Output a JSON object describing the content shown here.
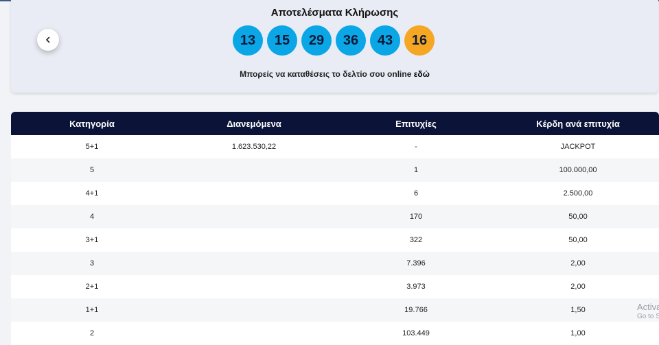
{
  "results": {
    "title": "Αποτελέσματα Κλήρωσης",
    "numbers": [
      "13",
      "15",
      "29",
      "36",
      "43"
    ],
    "bonus": "16",
    "online_text": "Μπορείς να καταθέσεις το δελτίο σου online",
    "online_link": "εδώ",
    "prev_icon": "chevron-left-icon"
  },
  "colors": {
    "main_ball": "#0aa6e6",
    "bonus_ball": "#f5a623",
    "table_header": "#0b1438"
  },
  "table": {
    "headers": [
      "Κατηγορία",
      "Διανεμόμενα",
      "Επιτυχίες",
      "Κέρδη ανά επιτυχία"
    ],
    "rows": [
      [
        "5+1",
        "1.623.530,22",
        "-",
        "JACKPOT"
      ],
      [
        "5",
        "",
        "1",
        "100.000,00"
      ],
      [
        "4+1",
        "",
        "6",
        "2.500,00"
      ],
      [
        "4",
        "",
        "170",
        "50,00"
      ],
      [
        "3+1",
        "",
        "322",
        "50,00"
      ],
      [
        "3",
        "",
        "7.396",
        "2,00"
      ],
      [
        "2+1",
        "",
        "3.973",
        "2,00"
      ],
      [
        "1+1",
        "",
        "19.766",
        "1,50"
      ],
      [
        "2",
        "",
        "103.449",
        "1,00"
      ]
    ]
  },
  "watermark": {
    "title": "Activa",
    "subtitle": "Go to S"
  }
}
